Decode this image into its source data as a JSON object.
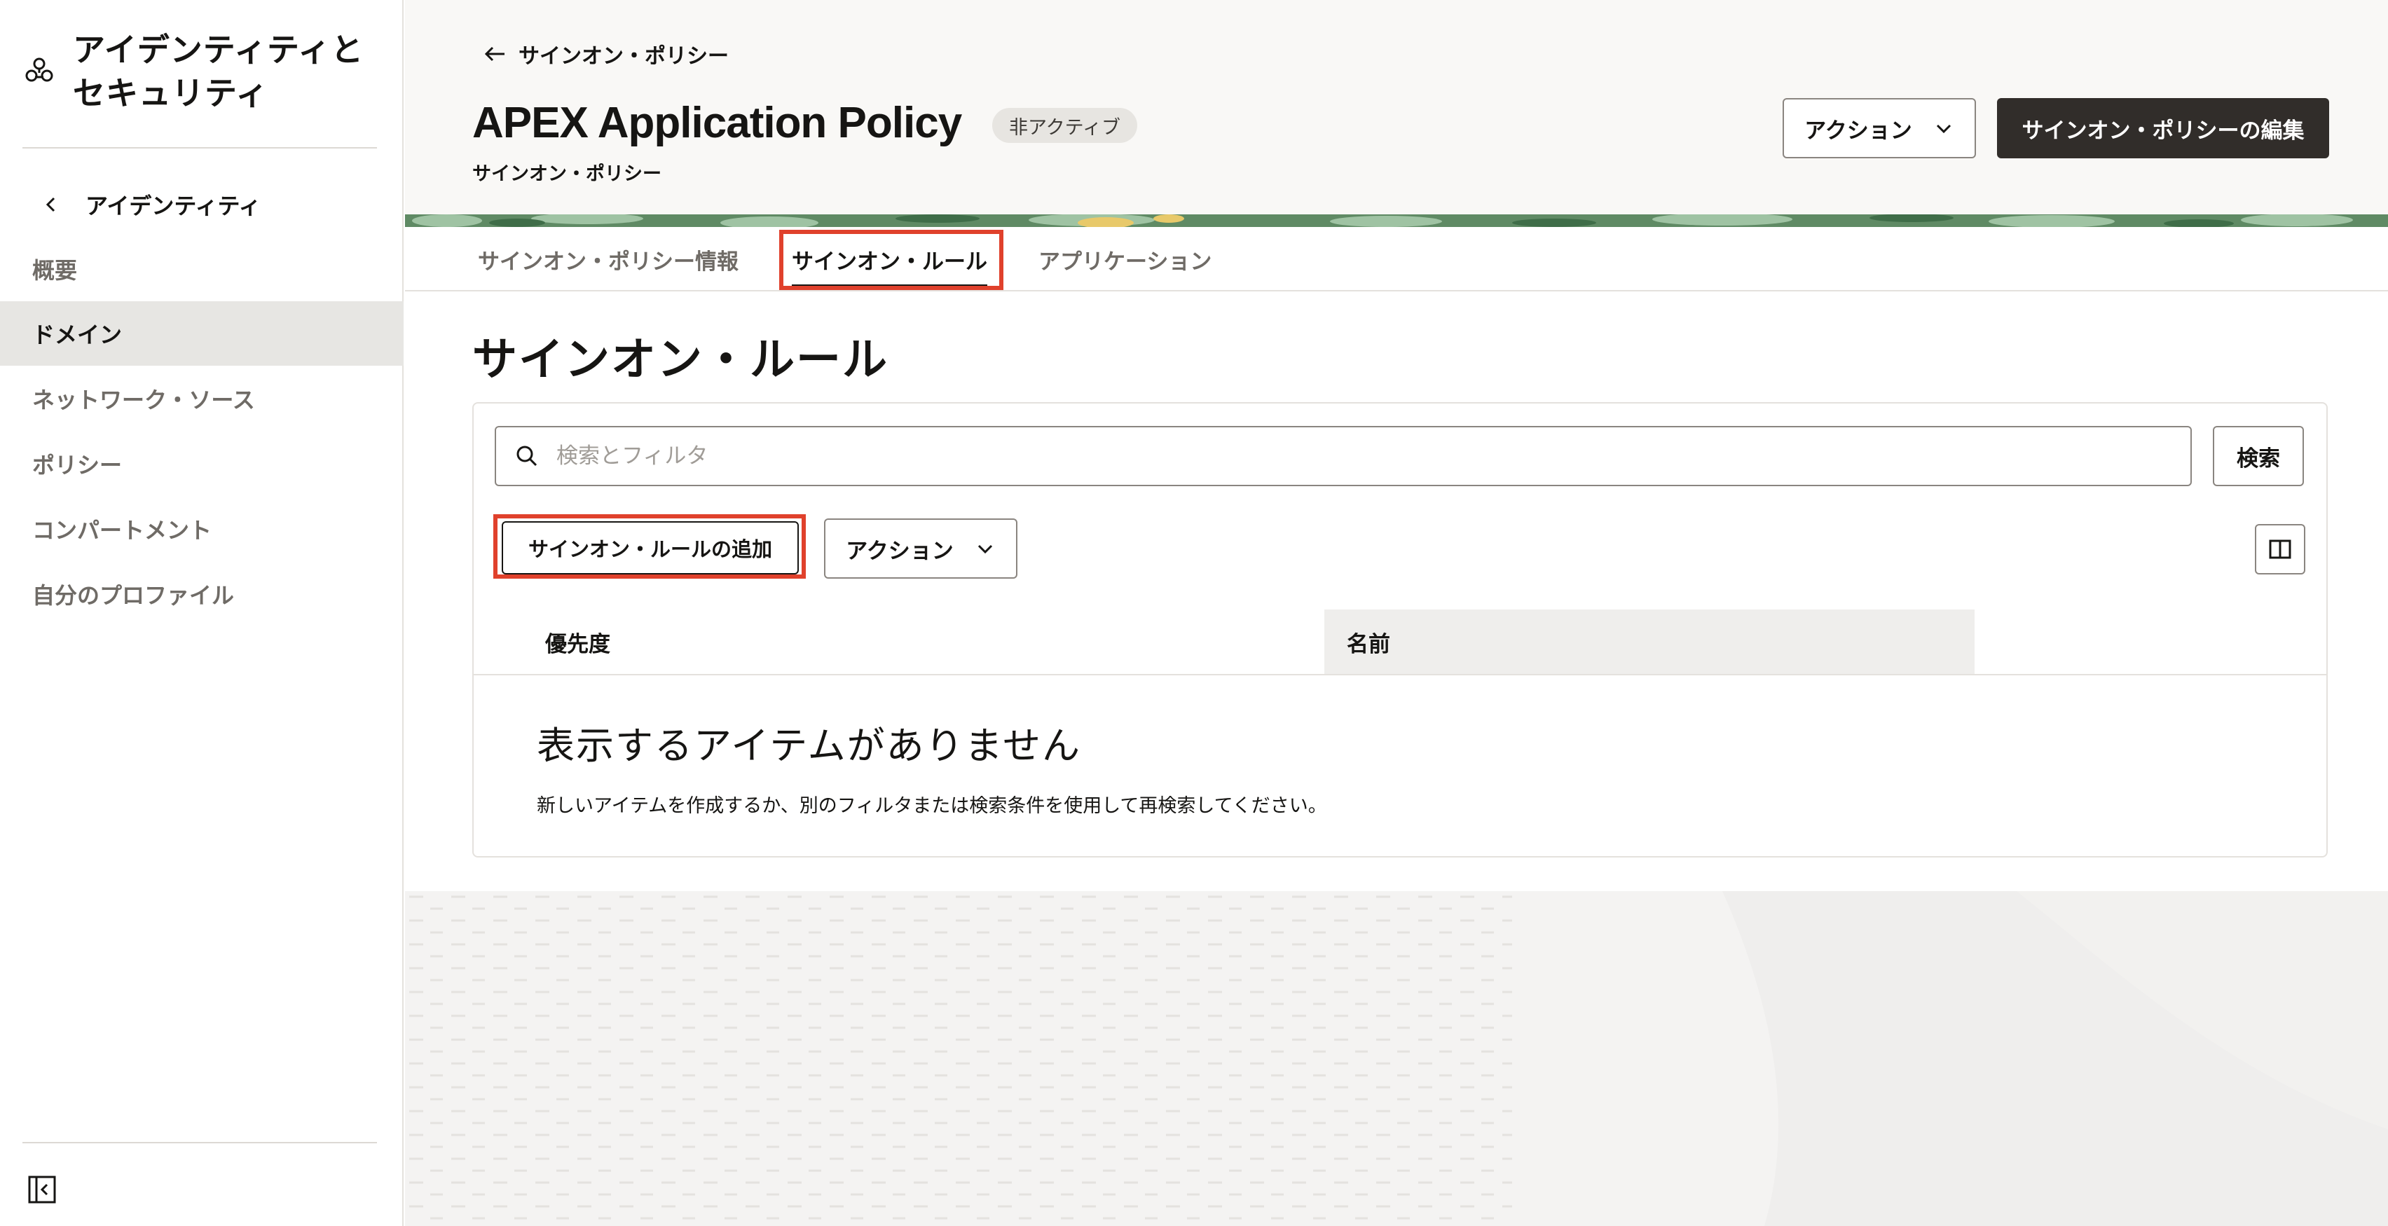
{
  "sidebar": {
    "title_line1": "アイデンティティと",
    "title_line2": "セキュリティ",
    "back_label": "アイデンティティ",
    "items": [
      {
        "label": "概要"
      },
      {
        "label": "ドメイン"
      },
      {
        "label": "ネットワーク・ソース"
      },
      {
        "label": "ポリシー"
      },
      {
        "label": "コンパートメント"
      },
      {
        "label": "自分のプロファイル"
      }
    ],
    "active_item": "ドメイン"
  },
  "header": {
    "breadcrumb": "サインオン・ポリシー",
    "title": "APEX Application Policy",
    "status_badge": "非アクティブ",
    "subtitle": "サインオン・ポリシー",
    "actions_button": "アクション",
    "edit_button": "サインオン・ポリシーの編集"
  },
  "tabs": [
    {
      "label": "サインオン・ポリシー情報"
    },
    {
      "label": "サインオン・ルール"
    },
    {
      "label": "アプリケーション"
    }
  ],
  "active_tab": "サインオン・ルール",
  "main": {
    "section_title": "サインオン・ルール",
    "search_placeholder": "検索とフィルタ",
    "search_button": "検索",
    "add_rule_button": "サインオン・ルールの追加",
    "actions_button": "アクション",
    "table": {
      "columns": [
        "優先度",
        "名前"
      ],
      "rows": []
    },
    "empty_title": "表示するアイテムがありません",
    "empty_description": "新しいアイテムを作成するか、別のフィルタまたは検索条件を使用して再検索してください。"
  },
  "colors": {
    "highlight": "#e0412c",
    "primary_button": "#312d2a",
    "active_nav": "#e7e6e3",
    "header_bg": "#f9f8f6"
  }
}
